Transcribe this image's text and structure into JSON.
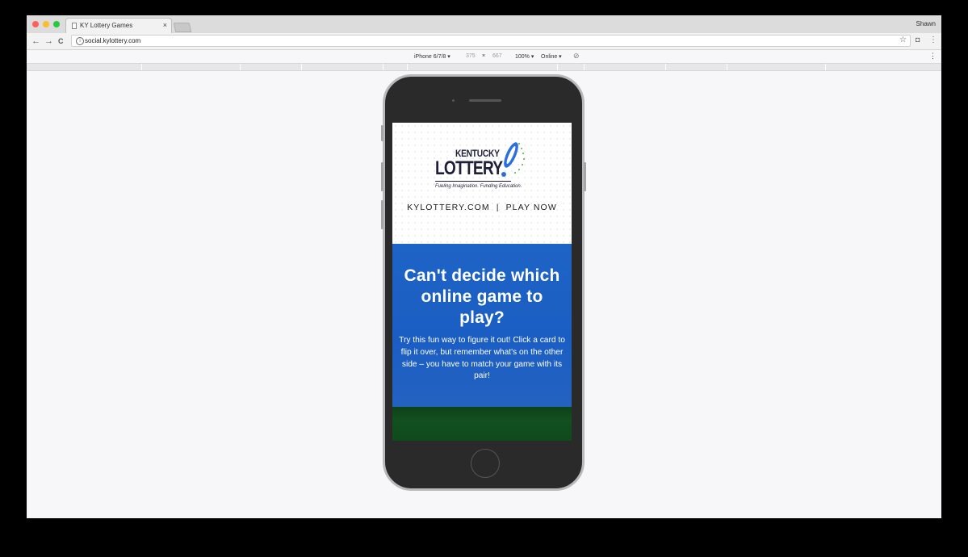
{
  "browser": {
    "tab_title": "KY Lottery Games",
    "tab_close": "×",
    "user_name": "Shawn",
    "url": "social.kylottery.com",
    "nav": {
      "back": "←",
      "forward": "→",
      "reload": "C",
      "star": "☆",
      "menu": "⋮"
    }
  },
  "device_toolbar": {
    "device": "iPhone 6/7/8 ▾",
    "width": "375",
    "times": "×",
    "height": "667",
    "zoom": "100% ▾",
    "network": "Online ▾",
    "menu": "⋮"
  },
  "page": {
    "logo": {
      "kentucky": "KENTUCKY",
      "lottery": "LOTTERY",
      "tagline": "Fueling Imagination. Funding Education."
    },
    "nav": {
      "site_link": "KYLOTTERY.COM",
      "separator": "|",
      "play_link": "PLAY NOW"
    },
    "hero": {
      "heading": "Can't decide which online game to play?",
      "body": "Try this fun way to figure it out! Click a card to flip it over, but remember what's on the other side – you have to match your game with its pair!"
    }
  },
  "colors": {
    "hero_blue": "#1e63c6",
    "logo_navy": "#1f1f3a",
    "logo_accent_blue": "#2a6fdb",
    "logo_accent_green": "#4caf50",
    "grass_green": "#0f4a1c"
  }
}
